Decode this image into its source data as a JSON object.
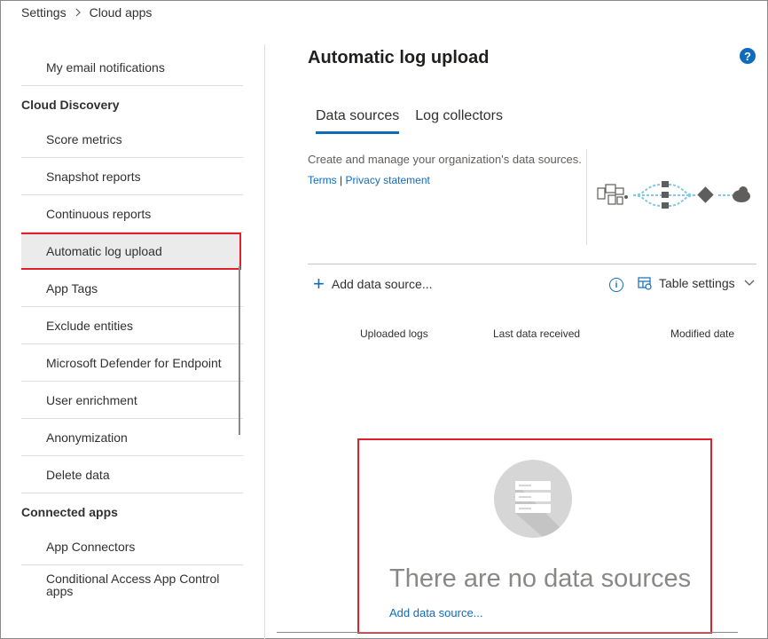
{
  "breadcrumb": {
    "root": "Settings",
    "current": "Cloud apps"
  },
  "sidebar": {
    "partial_item": "My email notifications",
    "cloud_discovery": {
      "heading": "Cloud Discovery",
      "items": [
        "Score metrics",
        "Snapshot reports",
        "Continuous reports",
        "Automatic log upload",
        "App Tags",
        "Exclude entities",
        "Microsoft Defender for Endpoint",
        "User enrichment",
        "Anonymization",
        "Delete data"
      ],
      "selected": "Automatic log upload"
    },
    "connected_apps": {
      "heading": "Connected apps",
      "items": [
        "App Connectors",
        "Conditional Access App Control apps"
      ]
    }
  },
  "main": {
    "title": "Automatic log upload",
    "help": "?",
    "tabs": [
      {
        "label": "Data sources",
        "active": true
      },
      {
        "label": "Log collectors",
        "active": false
      }
    ],
    "description": "Create and manage your organization's data sources.",
    "terms": "Terms",
    "links_separator": "|",
    "privacy": "Privacy statement",
    "toolbar": {
      "add_label": "Add data source...",
      "info": "i",
      "table_settings": "Table settings"
    },
    "columns": [
      "Uploaded logs",
      "Last data received",
      "Modified date"
    ],
    "empty_state": {
      "title": "There are no data sources",
      "link": "Add data source..."
    }
  },
  "colors": {
    "accent": "#0f6cbd",
    "highlight": "#e0202b",
    "selected_bg": "#ebebeb"
  }
}
